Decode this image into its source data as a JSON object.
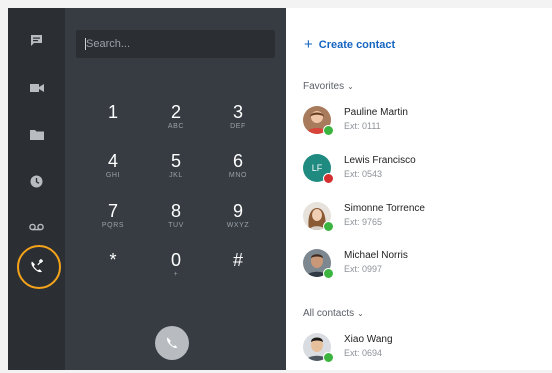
{
  "search": {
    "placeholder": "Search..."
  },
  "keypad": [
    {
      "num": "1",
      "letters": ""
    },
    {
      "num": "2",
      "letters": "ABC"
    },
    {
      "num": "3",
      "letters": "DEF"
    },
    {
      "num": "4",
      "letters": "GHI"
    },
    {
      "num": "5",
      "letters": "JKL"
    },
    {
      "num": "6",
      "letters": "MNO"
    },
    {
      "num": "7",
      "letters": "PQRS"
    },
    {
      "num": "8",
      "letters": "TUV"
    },
    {
      "num": "9",
      "letters": "WXYZ"
    },
    {
      "num": "*",
      "letters": ""
    },
    {
      "num": "0",
      "letters": "+"
    },
    {
      "num": "#",
      "letters": ""
    }
  ],
  "sidebar": {
    "icons": [
      "chat-icon",
      "video-icon",
      "folder-icon",
      "history-icon",
      "voicemail-icon",
      "dialpad-call-icon"
    ]
  },
  "contacts_panel": {
    "create_label": "Create contact",
    "favorites_label": "Favorites",
    "all_label": "All contacts",
    "favorites": [
      {
        "name": "Pauline Martin",
        "ext": "Ext: 0111",
        "status": "#3cb540",
        "initials": ""
      },
      {
        "name": "Lewis Francisco",
        "ext": "Ext: 0543",
        "status": "#d32f2f",
        "initials": "LF"
      },
      {
        "name": "Simonne Torrence",
        "ext": "Ext: 9765",
        "status": "#3cb540",
        "initials": ""
      },
      {
        "name": "Michael Norris",
        "ext": "Ext: 0997",
        "status": "#3cb540",
        "initials": ""
      }
    ],
    "all": [
      {
        "name": "Xiao Wang",
        "ext": "Ext: 0694",
        "status": "#3cb540",
        "initials": ""
      }
    ]
  },
  "colors": {
    "accent": "#1565c0",
    "highlight": "#f5a31a",
    "online": "#3cb540",
    "busy": "#d32f2f"
  }
}
